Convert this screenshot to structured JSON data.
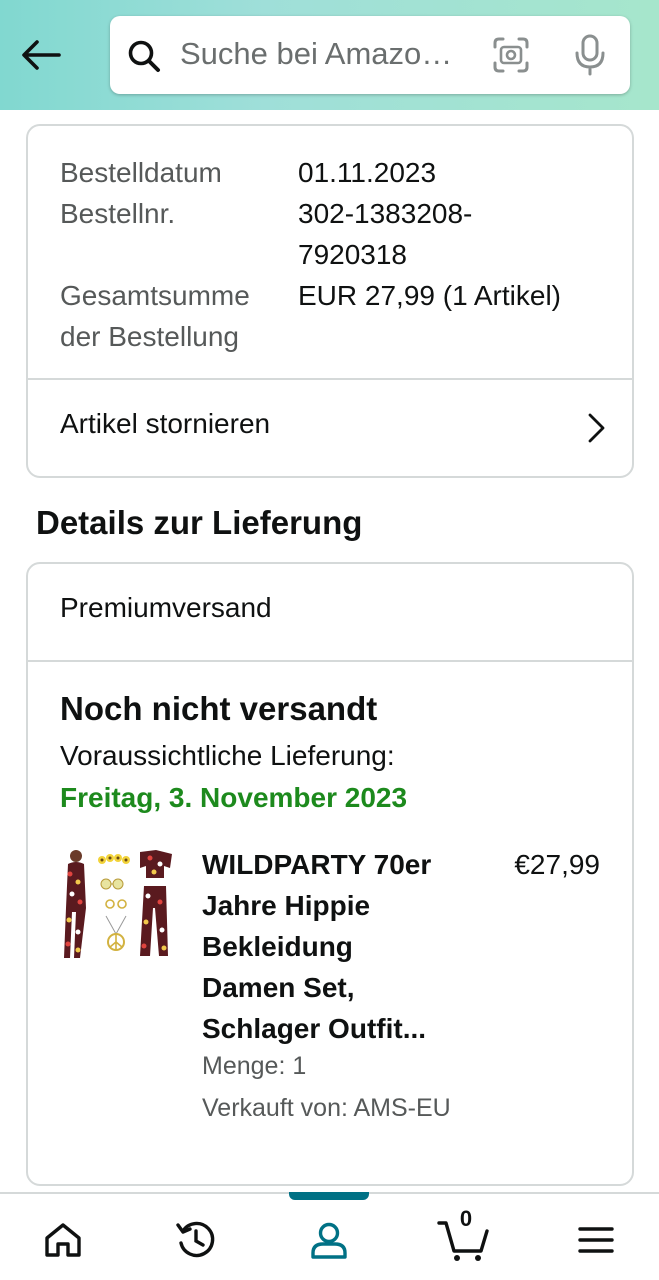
{
  "header": {
    "search_placeholder": "Suche bei Amazo…"
  },
  "order": {
    "date_label": "Bestelldatum",
    "date_value": "01.11.2023",
    "number_label": "Bestellnr.",
    "number_value_line1": "302-1383208-",
    "number_value_line2": "7920318",
    "total_label_line1": "Gesamtsumme",
    "total_label_line2": "der Bestellung",
    "total_value": "EUR 27,99 (1 Artikel)",
    "cancel_label": "Artikel stornieren"
  },
  "delivery": {
    "section_title": "Details zur Lieferung",
    "shipping_type": "Premiumversand",
    "status": "Noch nicht versandt",
    "eta_label": "Voraussichtliche Lieferung:",
    "eta_date": "Freitag, 3. November 2023",
    "product": {
      "title_lines": [
        "WILDPARTY 70er",
        "Jahre Hippie",
        "Bekleidung",
        "Damen Set,",
        "Schlager Outfit..."
      ],
      "price": "€27,99",
      "quantity": "Menge: 1",
      "seller": "Verkauft von: AMS-EU"
    }
  },
  "nav": {
    "items": [
      "home-icon",
      "history-icon",
      "account-icon",
      "cart-icon",
      "menu-icon"
    ],
    "cart_count": "0",
    "accent_color": "#007185"
  },
  "colors": {
    "eta_green": "#1d8a1d",
    "header_gradient_start": "#81d8d0",
    "header_gradient_end": "#a6e6cc"
  }
}
